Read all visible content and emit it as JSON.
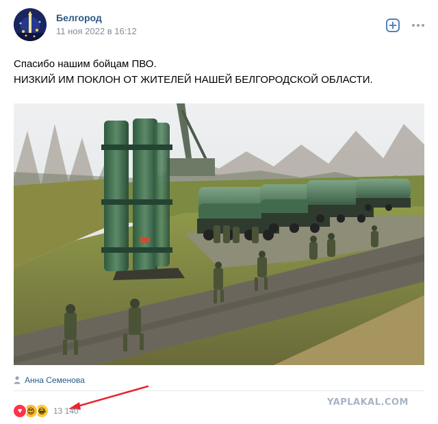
{
  "post": {
    "group_name": "Белгород",
    "date": "11 ноя 2022 в 16:12",
    "text_lines": [
      "Спасибо нашим бойцам ПВО.",
      "НИЗКИЙ ИМ ПОКЛОН ОТ ЖИТЕЛЕЙ НАШЕЙ БЕЛГОРОДСКОЙ ОБЛАСТИ."
    ],
    "author": "Анна Семенова",
    "reactions": {
      "icons": [
        "heart-reaction-icon",
        "love-reaction-icon",
        "laugh-reaction-icon"
      ],
      "count": "13 140"
    }
  },
  "header_actions": {
    "add_icon": "plus-square-icon",
    "more_icon": "ellipsis-icon"
  },
  "watermark": "YAPLAKAL.COM",
  "colors": {
    "link": "#2a5885",
    "muted": "#818c99",
    "accent": "#5181b8",
    "arrow": "#e8242c",
    "heart": "#ff3347"
  }
}
